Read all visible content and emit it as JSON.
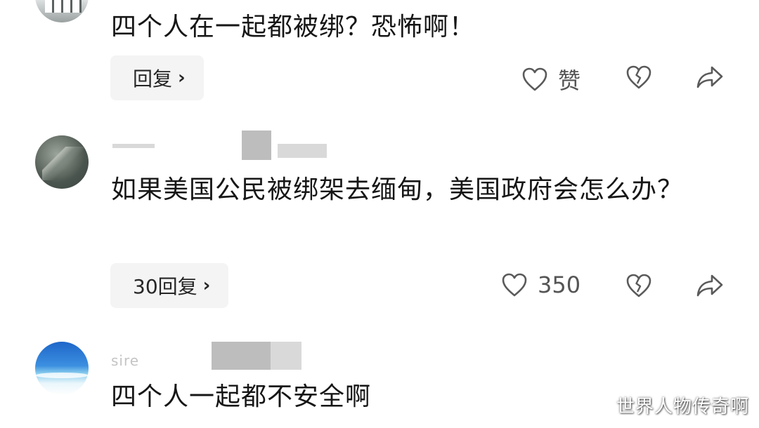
{
  "comments": [
    {
      "text": "四个人在一起都被绑？恐怖啊！",
      "reply_label": "回复",
      "like_label": "赞"
    },
    {
      "text": "如果美国公民被绑架去缅甸，美国政府会怎么办？",
      "reply_label": "30回复",
      "like_label": "350"
    },
    {
      "username": "sire",
      "text": "四个人一起都不安全啊"
    }
  ],
  "icons": {
    "like": "heart-outline-icon",
    "dislike": "broken-heart-icon",
    "share": "share-arrow-icon",
    "chevron": "chevron-right-icon"
  },
  "watermark": "世界人物传奇啊",
  "colors": {
    "text": "#161616",
    "icon": "#5a5a5a",
    "pill_bg": "#f4f4f4",
    "muted": "#c4c4c4"
  }
}
